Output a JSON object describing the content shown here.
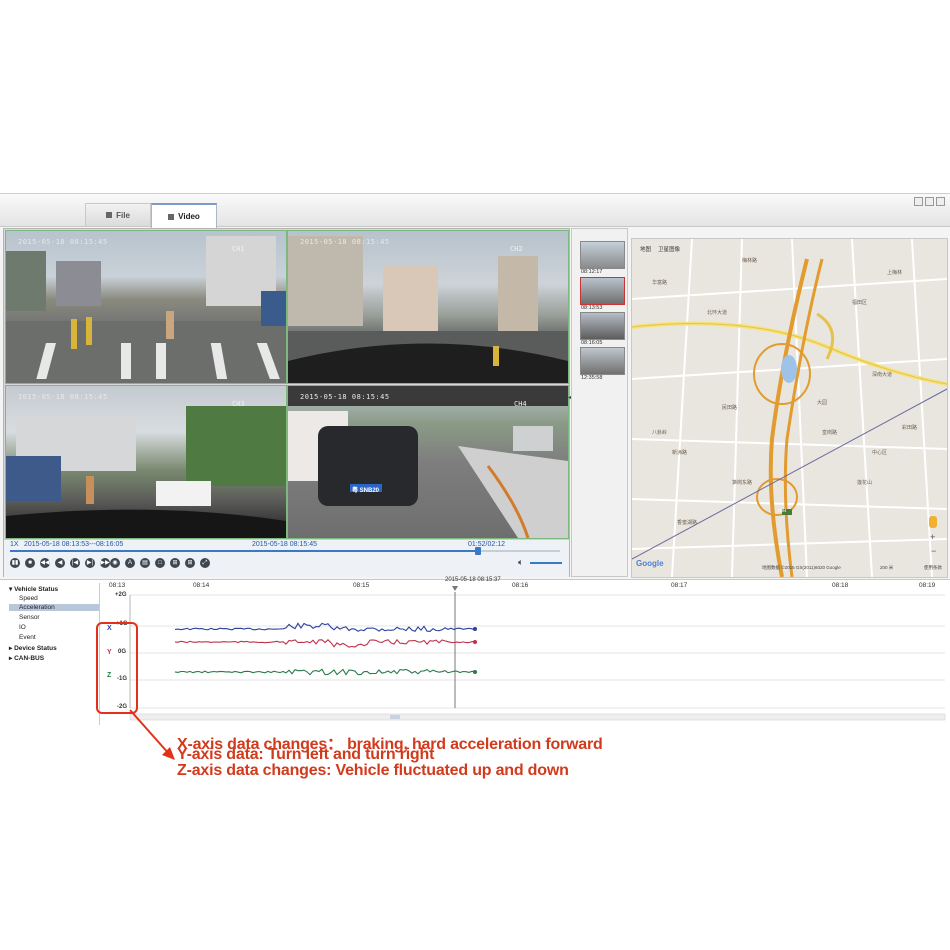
{
  "tabs": [
    {
      "label": "File"
    },
    {
      "label": "Video"
    }
  ],
  "cameras": [
    {
      "timestamp": "2015-05-18 08:15:45",
      "channel": "CH1"
    },
    {
      "timestamp": "2015-05-18 08:15:45",
      "channel": "CH2"
    },
    {
      "timestamp": "2015-05-18 08:15:45",
      "channel": "CH3"
    },
    {
      "timestamp": "2015-05-18 08:15:45",
      "channel": "CH4"
    }
  ],
  "plate": "粤 SNB20",
  "playback": {
    "speed": "1X",
    "range": "2015-05-18 08:13:53---08:16:05",
    "current": "2015-05-18 08:15:45",
    "position": "01:52/02:12",
    "progress": 0.85
  },
  "thumbnails": [
    {
      "time": "08:12:17"
    },
    {
      "time": "08:13:53"
    },
    {
      "time": "08:16:05"
    },
    {
      "time": "12:35:58"
    }
  ],
  "map": {
    "mode": "地图",
    "mode2": "卫星图像",
    "google": "Google",
    "copyright": "地图数据 ©2015 GS(2011)6020 Google",
    "scale": "200 米",
    "terms": "使用条款",
    "zoom_in": "+",
    "zoom_out": "−",
    "labels": [
      "梅林路",
      "深南大道",
      "华富路",
      "北环大道",
      "福田区",
      "民田路",
      "新洲路",
      "皇岗路",
      "彩田路",
      "上梅林",
      "笋岗东路",
      "八卦岭",
      "大园",
      "莲花山",
      "中心区",
      "香蜜湖路",
      "G94"
    ]
  },
  "tree": [
    {
      "label": "Vehicle Status",
      "expand": "▾"
    },
    {
      "label": "Speed"
    },
    {
      "label": "Acceleration"
    },
    {
      "label": "Sensor"
    },
    {
      "label": "IO"
    },
    {
      "label": "Event"
    },
    {
      "label": "Device Status",
      "expand": "▸"
    },
    {
      "label": "CAN-BUS",
      "expand": "▸"
    }
  ],
  "graph": {
    "cursor_label": "2015-05-18 08:15:37",
    "time_ticks": [
      "08:13",
      "08:14",
      "08:15",
      "08:16",
      "08:17",
      "08:18",
      "08:19"
    ],
    "y_ticks": [
      "+2G",
      "+1G",
      "0G",
      "-1G",
      "-2G"
    ],
    "axes": [
      {
        "letter": "X",
        "color": "#2e3f9e"
      },
      {
        "letter": "Y",
        "color": "#c0304a"
      },
      {
        "letter": "Z",
        "color": "#2a7a4a"
      }
    ]
  },
  "annotation": [
    "X-axis data changes：  braking, hard acceleration forward",
    "Y-axis data: Turn left and turn right",
    "Z-axis data changes:  Vehicle fluctuated up and down"
  ]
}
